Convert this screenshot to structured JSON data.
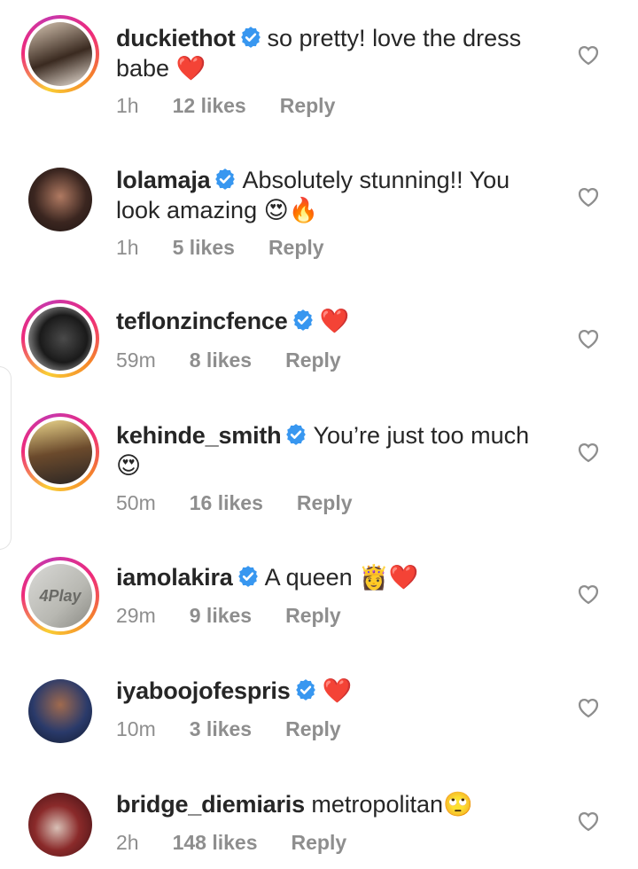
{
  "colors": {
    "text": "#262626",
    "meta": "#8e8e8e",
    "verified": "#3897f0",
    "heart": "#e0102a"
  },
  "icons": {
    "verified": "verified-badge-icon",
    "like": "heart-outline-icon"
  },
  "comments": [
    {
      "username": "duckiethot",
      "verified": true,
      "story_ring": true,
      "text_line1": "so pretty! love the dress",
      "text_line2": "babe",
      "emojis": "❤️",
      "time": "1h",
      "likes": "12 likes",
      "reply": "Reply"
    },
    {
      "username": "lolamaja",
      "verified": true,
      "story_ring": false,
      "text_line1": "Absolutely stunning!! You",
      "text_line2": "look amazing",
      "emojis": "😍🔥",
      "time": "1h",
      "likes": "5 likes",
      "reply": "Reply"
    },
    {
      "username": "teflonzincfence",
      "verified": true,
      "story_ring": true,
      "text_line1": "",
      "text_line2": "",
      "emojis": "❤️",
      "time": "59m",
      "likes": "8 likes",
      "reply": "Reply"
    },
    {
      "username": "kehinde_smith",
      "verified": true,
      "story_ring": true,
      "text_line1": "You’re just too much",
      "text_line2": "",
      "emojis": "😍",
      "time": "50m",
      "likes": "16 likes",
      "reply": "Reply"
    },
    {
      "username": "iamolakira",
      "verified": true,
      "story_ring": true,
      "text_line1": "A queen",
      "text_line2": "",
      "emojis": "👸❤️",
      "time": "29m",
      "likes": "9 likes",
      "reply": "Reply"
    },
    {
      "username": "iyaboojofespris",
      "verified": true,
      "story_ring": false,
      "text_line1": "",
      "text_line2": "",
      "emojis": "❤️",
      "time": "10m",
      "likes": "3 likes",
      "reply": "Reply"
    },
    {
      "username": "bridge_diemiaris",
      "verified": false,
      "story_ring": false,
      "text_line1": "metropolitan",
      "text_line2": "",
      "emojis": "🙄",
      "time": "2h",
      "likes": "148 likes",
      "reply": "Reply"
    }
  ]
}
